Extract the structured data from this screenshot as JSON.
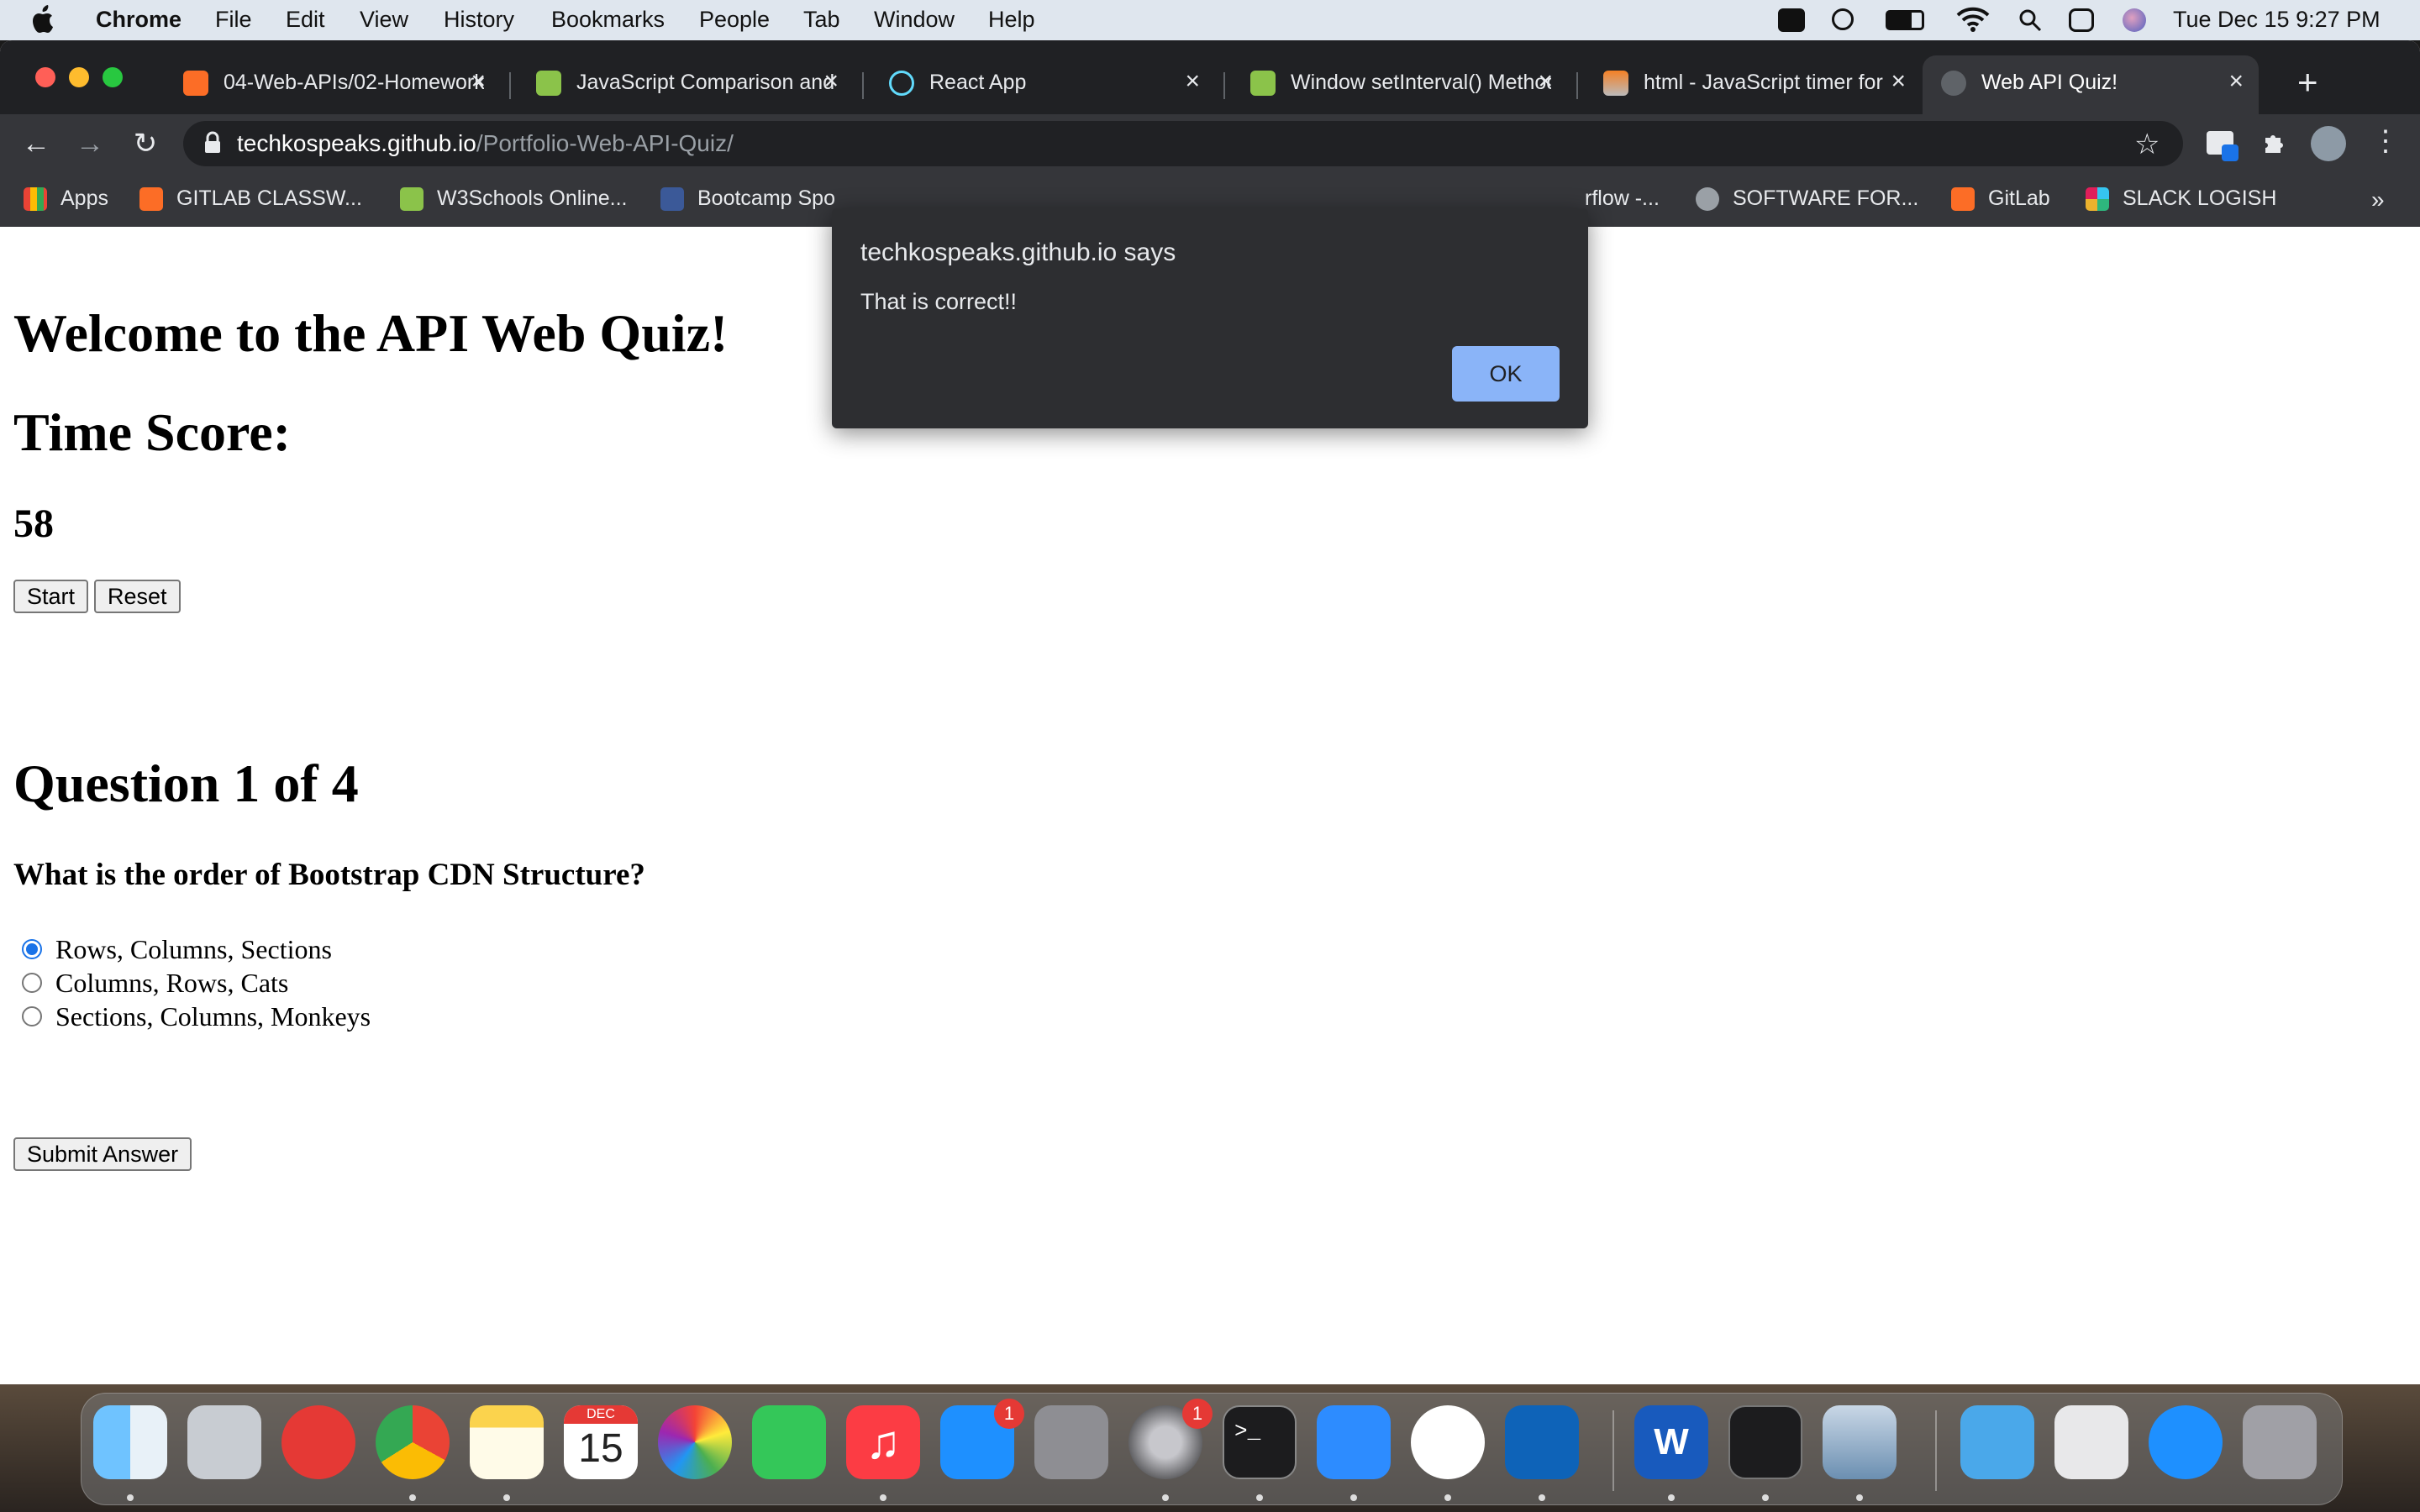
{
  "menubar": {
    "app_name": "Chrome",
    "menus": [
      "File",
      "Edit",
      "View",
      "History",
      "Bookmarks",
      "People",
      "Tab",
      "Window",
      "Help"
    ],
    "clock": "Tue Dec 15  9:27 PM"
  },
  "tabs": [
    {
      "title": "04-Web-APIs/02-Homework",
      "icon": "gitlab-icon"
    },
    {
      "title": "JavaScript Comparison and",
      "icon": "w3schools-icon"
    },
    {
      "title": "React App",
      "icon": "react-icon"
    },
    {
      "title": "Window setInterval() Method",
      "icon": "w3schools-icon"
    },
    {
      "title": "html - JavaScript timer for",
      "icon": "stackoverflow-icon"
    },
    {
      "title": "Web API Quiz!",
      "icon": "globe-icon",
      "active": true
    }
  ],
  "address": {
    "host": "techkospeaks.github.io",
    "path": "/Portfolio-Web-API-Quiz/"
  },
  "bookmarks": [
    {
      "label": "Apps",
      "icon": "apps-grid-icon"
    },
    {
      "label": "GITLAB CLASSW...",
      "icon": "gitlab-icon"
    },
    {
      "label": "W3Schools Online...",
      "icon": "w3schools-icon"
    },
    {
      "label": "Bootcamp Spo",
      "icon": "bootcamp-shield-icon"
    },
    {
      "label": "rflow -...",
      "icon": "stackoverflow-icon"
    },
    {
      "label": "SOFTWARE FOR...",
      "icon": "apple-icon"
    },
    {
      "label": "GitLab",
      "icon": "gitlab-icon"
    },
    {
      "label": "SLACK LOGISH",
      "icon": "slack-icon"
    }
  ],
  "page": {
    "title": "Welcome to the API Web Quiz!",
    "score_heading": "Time Score:",
    "score_value": "58",
    "start_label": "Start",
    "reset_label": "Reset",
    "question_heading": "Question 1 of 4",
    "question_text": "What is the order of Bootstrap CDN Structure?",
    "options": [
      {
        "label": "Rows, Columns, Sections",
        "selected": true
      },
      {
        "label": "Columns, Rows, Cats",
        "selected": false
      },
      {
        "label": "Sections, Columns, Monkeys",
        "selected": false
      }
    ],
    "submit_label": "Submit Answer"
  },
  "alert": {
    "title": "techkospeaks.github.io says",
    "message": "That is correct!!",
    "ok_label": "OK"
  },
  "dock": {
    "calendar_month": "DEC",
    "calendar_day": "15",
    "app_store_badge": "1",
    "settings_badge": "1",
    "word_letter": "W"
  },
  "colors": {
    "tab_strip": "#202124",
    "toolbar": "#35363a",
    "alert_bg": "#2d2e31",
    "ok_button": "#8ab4f8",
    "radio_selected": "#1a73e8"
  }
}
